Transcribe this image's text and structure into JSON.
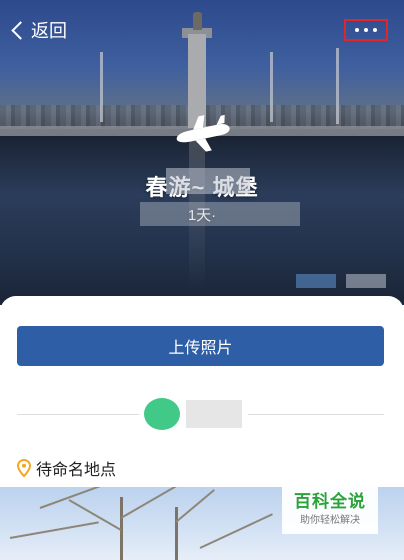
{
  "header": {
    "back_label": "返回",
    "back_icon": "chevron-left-icon",
    "more_icon": "more-dots-icon",
    "highlight_color": "#e0252b"
  },
  "hero": {
    "icon": "airplane-icon",
    "title": "春游~      城堡",
    "subtitle": "1天·"
  },
  "actions": {
    "upload_label": "上传照片",
    "upload_color": "#2e5fa6"
  },
  "location": {
    "icon": "map-pin-icon",
    "label": "待命名地点",
    "icon_color": "#f5a623"
  },
  "watermark": {
    "title": "百科全说",
    "subtitle": "助你轻松解决",
    "color": "#2ba23a"
  }
}
